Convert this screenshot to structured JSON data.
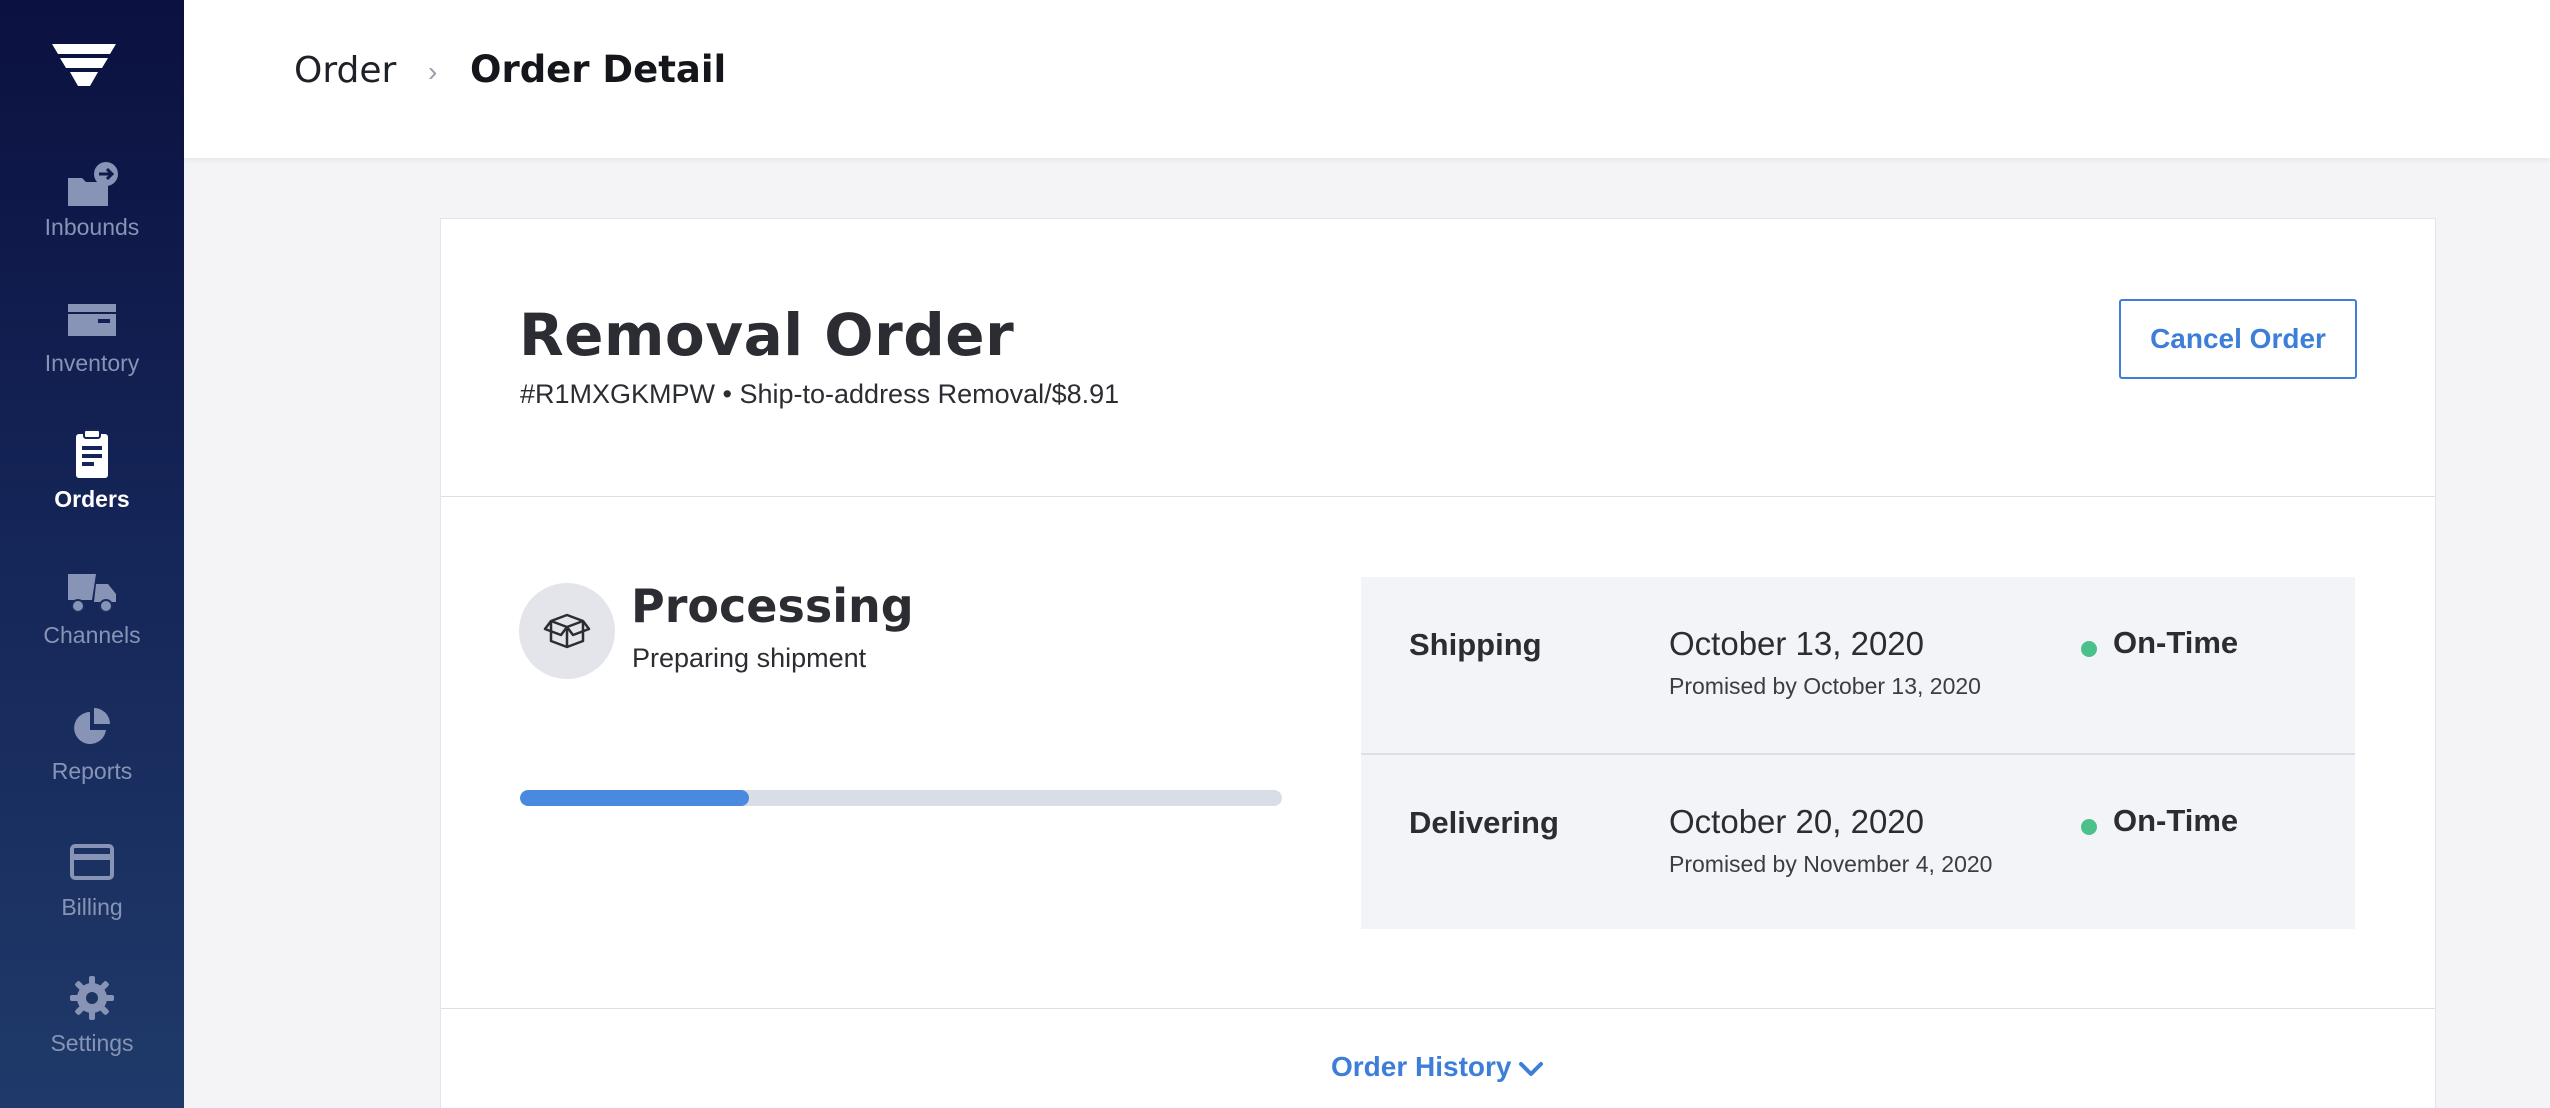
{
  "sidebar": {
    "logo_icon": "company-logo-icon",
    "items": [
      {
        "label": "Inbounds",
        "icon": "inbound-box-icon",
        "active": false
      },
      {
        "label": "Inventory",
        "icon": "inventory-icon",
        "active": false
      },
      {
        "label": "Orders",
        "icon": "clipboard-icon",
        "active": true
      },
      {
        "label": "Channels",
        "icon": "truck-icon",
        "active": false
      },
      {
        "label": "Reports",
        "icon": "pie-chart-icon",
        "active": false
      },
      {
        "label": "Billing",
        "icon": "credit-card-icon",
        "active": false
      },
      {
        "label": "Settings",
        "icon": "gear-icon",
        "active": false
      }
    ]
  },
  "header": {
    "breadcrumb_root": "Order",
    "breadcrumb_separator": "›",
    "breadcrumb_current": "Order Detail",
    "avatar_icon": "user-avatar-icon"
  },
  "order": {
    "title": "Removal Order",
    "subtitle": "#R1MXGKMPW • Ship-to-address Removal/$8.91",
    "cancel_label": "Cancel Order",
    "status": {
      "icon": "box-icon",
      "title": "Processing",
      "subtitle": "Preparing shipment",
      "progress": 0.3
    },
    "shipment_rows": [
      {
        "label": "Shipping",
        "date": "October 13, 2020",
        "promised": "Promised by October 13, 2020",
        "status": "On-Time",
        "status_color": "#4cc08a"
      },
      {
        "label": "Delivering",
        "date": "October 20, 2020",
        "promised": "Promised by November 4, 2020",
        "status": "On-Time",
        "status_color": "#4cc08a"
      }
    ],
    "history_label": "Order History",
    "history_icon": "chevron-down-icon"
  },
  "colors": {
    "accent": "#3d7fd8",
    "sidebar_top": "#0b1140",
    "sidebar_bottom": "#1f3a6a",
    "progress_fill": "#4a89e0",
    "on_time": "#4cc08a"
  }
}
